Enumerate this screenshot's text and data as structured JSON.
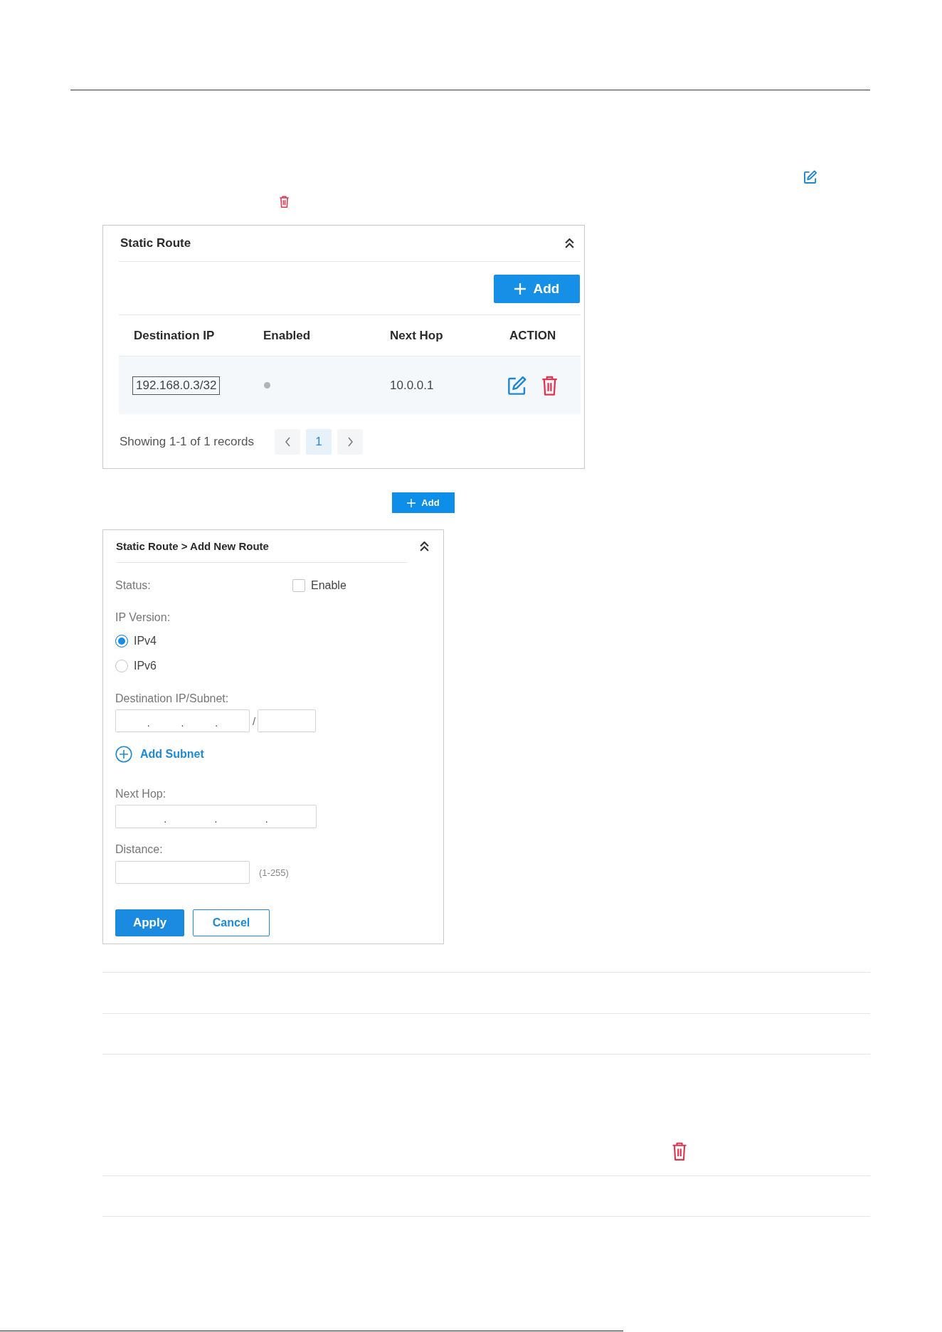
{
  "static_route": {
    "title": "Static Route",
    "add_button": {
      "label": "Add"
    },
    "columns": [
      "Destination IP",
      "Enabled",
      "Next Hop",
      "ACTION"
    ],
    "rows": [
      {
        "destination_ip": "192.168.0.3/32",
        "highlighted": true,
        "enabled": false,
        "next_hop": "10.0.0.1"
      }
    ],
    "pagination": {
      "summary": "Showing 1-1 of 1 records",
      "pages": [
        {
          "label": "1",
          "selected": true
        }
      ]
    }
  },
  "inline_add_button": {
    "label": "Add"
  },
  "add_route": {
    "title": "Static Route > Add New Route",
    "status": {
      "label": "Status:",
      "option": "Enable",
      "checked": false
    },
    "ip_version": {
      "label": "IP Version:",
      "options": [
        {
          "label": "IPv4",
          "selected": true
        },
        {
          "label": "IPv6",
          "selected": false
        }
      ]
    },
    "destination": {
      "label": "Destination IP/Subnet:",
      "separators": [
        ".",
        ".",
        "."
      ],
      "mask_separator": "/"
    },
    "add_subnet": {
      "label": "Add Subnet"
    },
    "next_hop": {
      "label": "Next Hop:",
      "separators": [
        ".",
        ".",
        "."
      ]
    },
    "distance": {
      "label": "Distance:",
      "hint": "(1-255)"
    },
    "buttons": [
      {
        "label": "Apply",
        "kind": "primary"
      },
      {
        "label": "Cancel",
        "kind": "secondary"
      }
    ]
  }
}
